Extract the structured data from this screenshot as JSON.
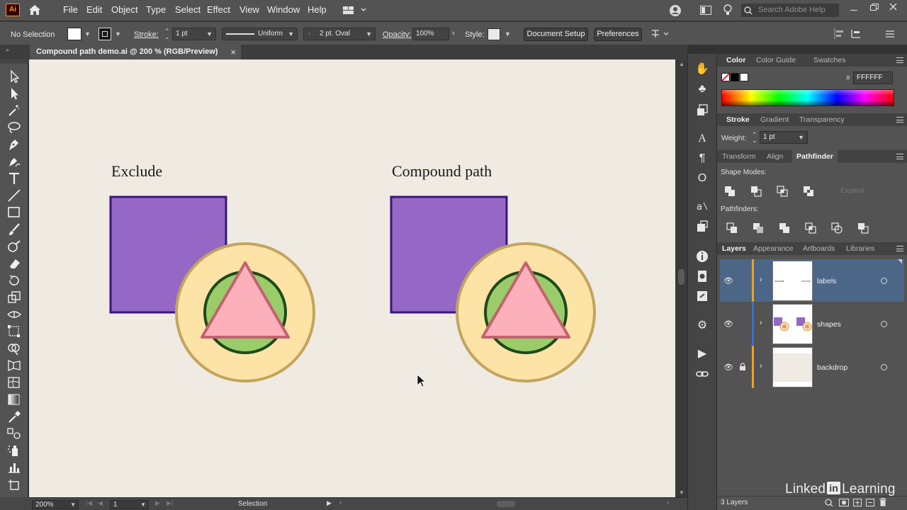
{
  "menubar": {
    "logo": "Ai",
    "items": [
      "File",
      "Edit",
      "Object",
      "Type",
      "Select",
      "Effect",
      "View",
      "Window",
      "Help"
    ],
    "search_placeholder": "Search Adobe Help"
  },
  "control_bar": {
    "selection_state": "No Selection",
    "stroke_label": "Stroke:",
    "stroke_weight": "1 pt",
    "stroke_profile": "Uniform",
    "brush": "2 pt. Oval",
    "opacity_label": "Opacity:",
    "opacity_value": "100%",
    "style_label": "Style:",
    "document_setup": "Document Setup",
    "preferences": "Preferences"
  },
  "document": {
    "tab_title": "Compound path demo.ai @ 200 % (RGB/Preview)",
    "close_glyph": "×"
  },
  "artboard": {
    "labels": [
      "Exclude",
      "Compound path"
    ],
    "colors": {
      "square_fill": "#9468c4",
      "square_stroke": "#3a1678",
      "circle_fill": "#fde3a6",
      "circle_stroke": "#c4a45e",
      "inner_circle_fill": "#9acd6a",
      "inner_circle_stroke": "#1e4a1a",
      "triangle_fill": "#fbb0bb",
      "triangle_stroke": "#c2636e",
      "background": "#efeae2"
    }
  },
  "status_bar": {
    "zoom": "200%",
    "artboard_number": "1",
    "tool": "Selection"
  },
  "color_panel": {
    "tabs": [
      "Color",
      "Color Guide",
      "Swatches"
    ],
    "hex_symbol": "#",
    "hex_value": "FFFFFF"
  },
  "stroke_panel": {
    "tabs": [
      "Stroke",
      "Gradient",
      "Transparency"
    ],
    "weight_label": "Weight:",
    "weight_value": "1 pt"
  },
  "pathfinder_panel": {
    "tabs": [
      "Transform",
      "Align",
      "Pathfinder"
    ],
    "shape_modes_label": "Shape Modes:",
    "expand_label": "Expand",
    "pathfinders_label": "Pathfinders:"
  },
  "layers_panel": {
    "tabs": [
      "Layers",
      "Appearance",
      "Artboards",
      "Libraries"
    ],
    "layers": [
      {
        "name": "labels",
        "color": "#f59e1a",
        "selected": true,
        "locked": false
      },
      {
        "name": "shapes",
        "color": "#3a6fd8",
        "selected": false,
        "locked": false
      },
      {
        "name": "backdrop",
        "color": "#f59e1a",
        "selected": false,
        "locked": true
      }
    ],
    "footer_count": "3 Layers"
  },
  "watermark": {
    "prefix": "Linked",
    "badge": "in",
    "suffix": "Learning"
  }
}
